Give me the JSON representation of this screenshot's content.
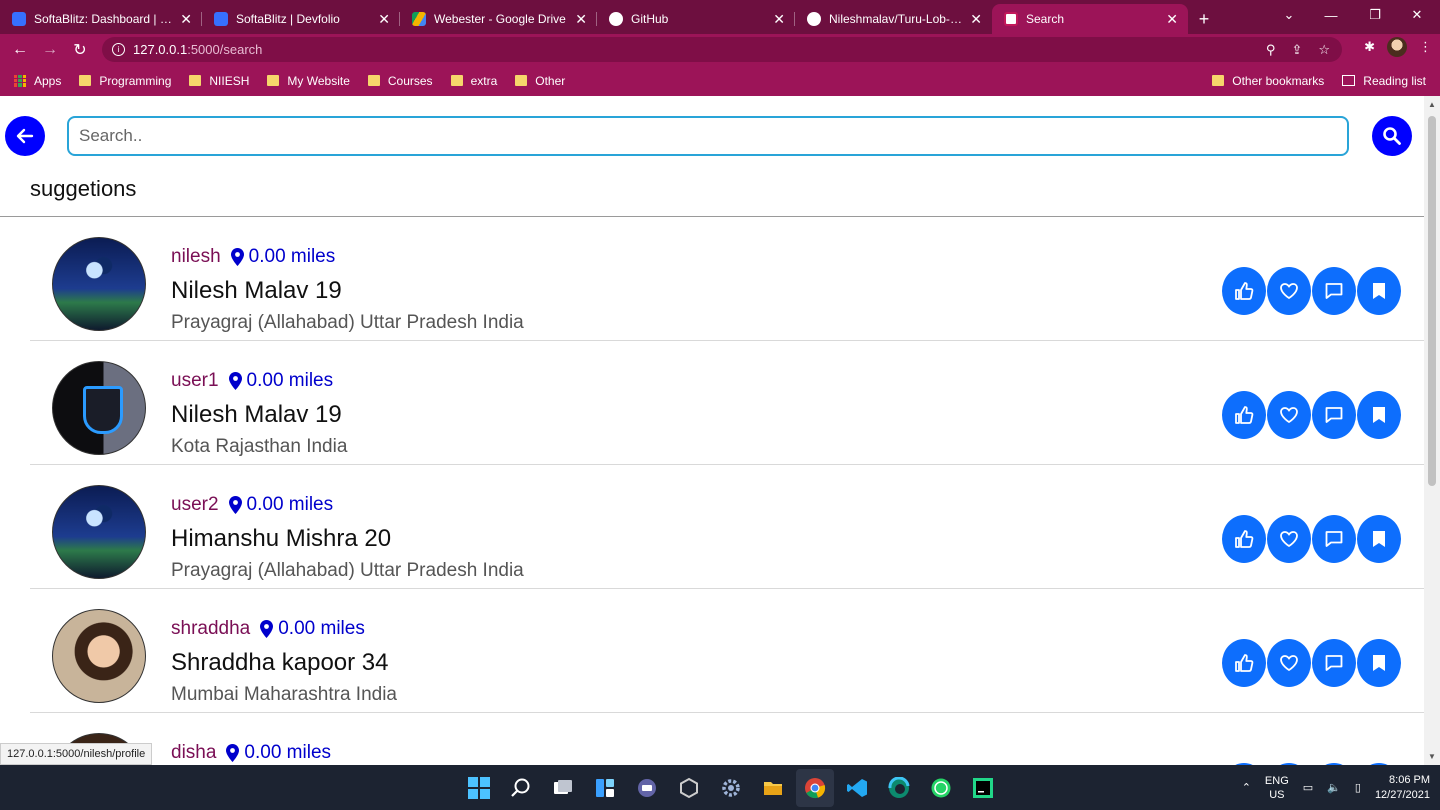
{
  "browser": {
    "tabs": [
      {
        "title": "SoftaBlitz: Dashboard | Devfolio",
        "favicon_color": "#3770ff",
        "active": false
      },
      {
        "title": "SoftaBlitz | Devfolio",
        "favicon_color": "#3770ff",
        "active": false
      },
      {
        "title": "Webester - Google Drive",
        "favicon_color": "#f4b400",
        "active": false
      },
      {
        "title": "GitHub",
        "favicon_color": "#ffffff",
        "active": false
      },
      {
        "title": "Nileshmalav/Turu-Lob-By-T",
        "favicon_color": "#ffffff",
        "active": false
      },
      {
        "title": "Search",
        "favicon_color": "#ffffff",
        "active": true
      }
    ],
    "new_tab": "+",
    "url_host": "127.0.0.1",
    "url_path": ":5000/search",
    "bookmarks": [
      "Programming",
      "NIIESH",
      "My Website",
      "Courses",
      "extra",
      "Other"
    ],
    "apps_label": "Apps",
    "other_bookmarks": "Other bookmarks",
    "reading_list": "Reading list"
  },
  "search": {
    "placeholder": "Search.."
  },
  "section_title": "suggetions",
  "users": [
    {
      "username": "nilesh",
      "distance": "0.00 miles",
      "name": "Nilesh Malav 19",
      "location": "Prayagraj (Allahabad) Uttar Pradesh India",
      "avatar": "night"
    },
    {
      "username": "user1",
      "distance": "0.00 miles",
      "name": "Nilesh Malav 19",
      "location": "Kota Rajasthan India",
      "avatar": "shield"
    },
    {
      "username": "user2",
      "distance": "0.00 miles",
      "name": "Himanshu Mishra 20",
      "location": "Prayagraj (Allahabad) Uttar Pradesh India",
      "avatar": "night"
    },
    {
      "username": "shraddha",
      "distance": "0.00 miles",
      "name": "Shraddha kapoor 34",
      "location": "Mumbai Maharashtra India",
      "avatar": "portrait"
    },
    {
      "username": "disha",
      "distance": "0.00 miles",
      "name": "",
      "location": "",
      "avatar": "partial"
    }
  ],
  "status_link": "127.0.0.1:5000/nilesh/profile",
  "taskbar": {
    "lang_top": "ENG",
    "lang_bottom": "US",
    "time": "8:06 PM",
    "date": "12/27/2021"
  },
  "colors": {
    "accent_button": "#0000ff",
    "action_button": "#0d6efd",
    "username": "#7a0f55",
    "distance": "#0000cc",
    "chrome": "#9c1458"
  }
}
